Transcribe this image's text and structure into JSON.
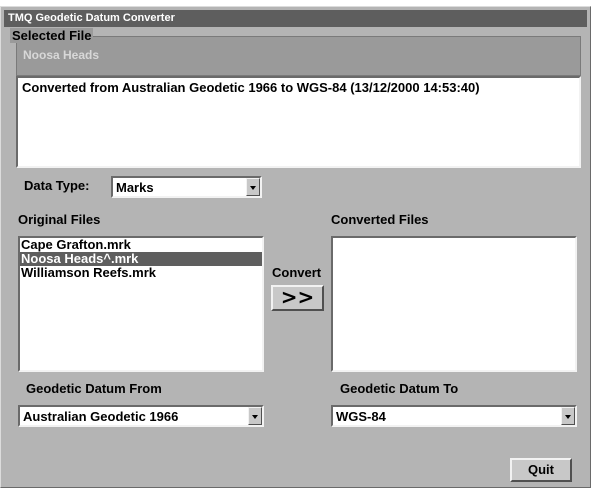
{
  "window": {
    "title": "TMQ  Geodetic Datum Converter"
  },
  "selected_file": {
    "label": "Selected File",
    "name": "Noosa Heads"
  },
  "message": "Converted from Australian Geodetic 1966 to WGS-84 (13/12/2000 14:53:40)",
  "data_type": {
    "label": "Data Type:",
    "value": "Marks"
  },
  "original_files": {
    "label": "Original Files",
    "items": [
      "Cape Grafton.mrk",
      "Noosa Heads^.mrk",
      "Williamson Reefs.mrk"
    ],
    "selected_index": 1
  },
  "converted_files": {
    "label": "Converted Files",
    "items": []
  },
  "convert": {
    "label": "Convert",
    "button_glyph": ">>"
  },
  "datum_from": {
    "label": "Geodetic Datum From",
    "value": "Australian Geodetic 1966"
  },
  "datum_to": {
    "label": "Geodetic Datum To",
    "value": "WGS-84"
  },
  "quit_label": "Quit"
}
